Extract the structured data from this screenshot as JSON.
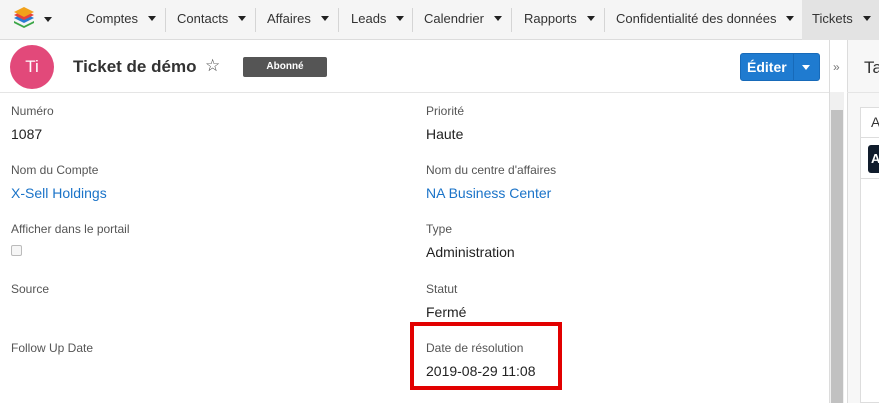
{
  "nav": {
    "items": [
      {
        "label": "Comptes"
      },
      {
        "label": "Contacts"
      },
      {
        "label": "Affaires"
      },
      {
        "label": "Leads"
      },
      {
        "label": "Calendrier"
      },
      {
        "label": "Rapports"
      },
      {
        "label": "Confidentialité des données"
      },
      {
        "label": "Tickets"
      }
    ],
    "active": "Tickets"
  },
  "header": {
    "avatar_initials": "Ti",
    "title": "Ticket de démo",
    "badge": "Abonné",
    "edit_label": "Éditer"
  },
  "fields": {
    "numero": {
      "label": "Numéro",
      "value": "1087"
    },
    "priorite": {
      "label": "Priorité",
      "value": "Haute"
    },
    "compte": {
      "label": "Nom du Compte",
      "value": "X-Sell Holdings"
    },
    "centre": {
      "label": "Nom du centre d'affaires",
      "value": "NA Business Center"
    },
    "portail": {
      "label": "Afficher dans le portail",
      "checked": false
    },
    "type": {
      "label": "Type",
      "value": "Administration"
    },
    "source": {
      "label": "Source"
    },
    "statut": {
      "label": "Statut",
      "value": "Fermé"
    },
    "followup": {
      "label": "Follow Up Date"
    },
    "resolution": {
      "label": "Date de résolution",
      "value": "2019-08-29 11:08"
    }
  },
  "side_panel": {
    "title_fragment": "Ta",
    "box_letter": "A",
    "dark_letter": "A"
  },
  "colors": {
    "avatar": "#e2497a",
    "primary_button": "#1f7bd0",
    "link": "#1a73c8",
    "highlight": "#e20000"
  }
}
